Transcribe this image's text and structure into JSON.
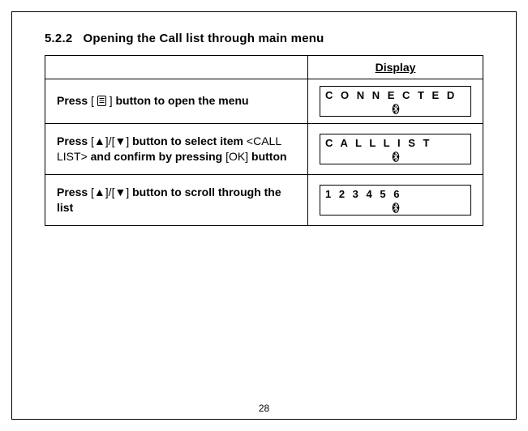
{
  "section_number": "5.2.2",
  "section_title": "Opening the Call list through main menu",
  "header": {
    "left": "",
    "right": "Display"
  },
  "rows": [
    {
      "instr_pre": "Press ",
      "after_key": " button to open the menu",
      "lcd": "C O N N E C T E D"
    },
    {
      "instr_pre": "Press ",
      "arrow_keys": "[▲]/[▼]",
      "mid1": " button to select item ",
      "item": "<CALL LIST>",
      "mid2": " and confirm by pressing ",
      "ok_key": "[OK]",
      "after_key": " button",
      "lcd": "C A L L    L I S T"
    },
    {
      "instr_pre": "Press ",
      "arrow_keys": "[▲]/[▼]",
      "after_key": " button to scroll through the list",
      "lcd": "1 2 3 4 5 6"
    }
  ],
  "page_number": "28"
}
